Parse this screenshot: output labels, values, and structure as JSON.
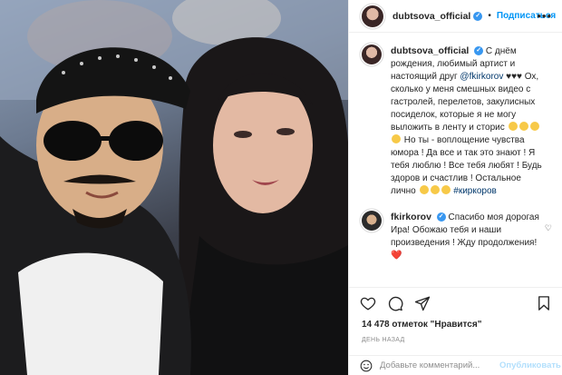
{
  "post": {
    "username": "dubtsova_official",
    "follow_label": "Подписаться",
    "more_label": "•••"
  },
  "comments": [
    {
      "username": "dubtsova_official",
      "segments": [
        "С днём рождения, любимый артист и настоящий друг",
        "@fkirkorov",
        "♥♥♥ Ох, сколько у меня смешных видео с гастролей, перелетов, закулисных посиделок, которые я не могу выложить в ленту и сторис",
        "Но ты - воплощение чувства юмора ! Да все и так это знают ! Я тебя люблю ! Все тебя любят ! Будь здоров и счастлив ! Остальное лично",
        "#киркоров"
      ]
    },
    {
      "username": "fkirkorov",
      "text": "Спасибо моя дорогая Ира! Обожаю тебя и наши произведения ! Жду продолжения!",
      "emoji": "❤️"
    }
  ],
  "likes": {
    "count": "14 478",
    "label": "отметок \"Нравится\""
  },
  "date": "ДЕНЬ НАЗАД",
  "add_comment": {
    "placeholder": "Добавьте комментарий...",
    "publish_label": "Опубликовать"
  },
  "icons": [
    "heart-icon",
    "comment-icon",
    "share-icon",
    "bookmark-icon",
    "smile-icon",
    "verified-badge-icon",
    "more-icon"
  ],
  "colors": {
    "accent": "#0095f6",
    "verified": "#3897f0",
    "mention": "#00376b",
    "muted": "#8e8e8e",
    "publish_disabled": "#b2dffc"
  }
}
